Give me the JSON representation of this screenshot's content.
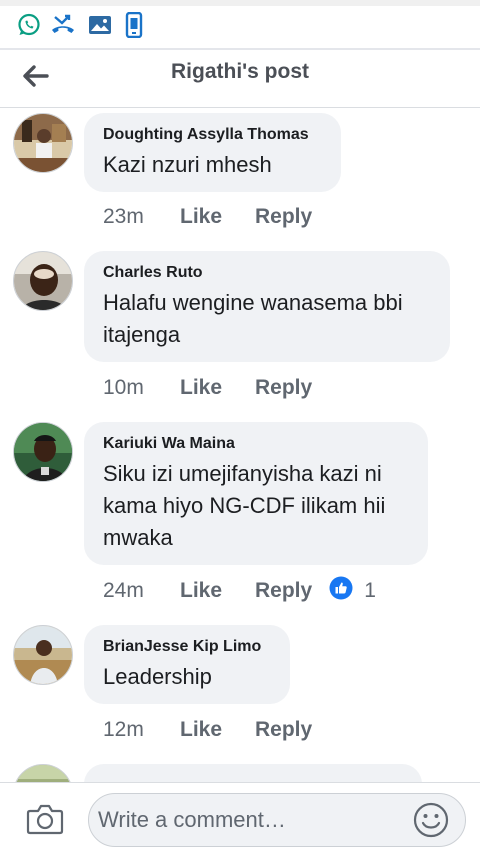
{
  "statusbar": {
    "icons": [
      "whatsapp-icon",
      "missed-call-icon",
      "gallery-icon",
      "phone-screen-icon"
    ]
  },
  "header": {
    "title": "Rigathi's post"
  },
  "comments": [
    {
      "author": "Doughting Assylla Thomas",
      "text": "Kazi nzuri mhesh",
      "time": "23m",
      "like_label": "Like",
      "reply_label": "Reply"
    },
    {
      "author": "Charles Ruto",
      "text": "Halafu wengine wanasema bbi itajenga",
      "time": "10m",
      "like_label": "Like",
      "reply_label": "Reply"
    },
    {
      "author": "Kariuki Wa Maina",
      "text": "Siku izi umejifanyisha kazi ni kama hiyo NG-CDF ilikam hii mwaka",
      "time": "24m",
      "like_label": "Like",
      "reply_label": "Reply",
      "reaction": {
        "type": "like",
        "count": "1"
      }
    },
    {
      "author": "BrianJesse Kip Limo",
      "text": "Leadership",
      "time": "12m",
      "like_label": "Like",
      "reply_label": "Reply"
    }
  ],
  "composer": {
    "placeholder": "Write a comment…"
  },
  "colors": {
    "accent": "#1877f2",
    "bubble": "#f0f2f5",
    "meta_text": "#606770"
  }
}
